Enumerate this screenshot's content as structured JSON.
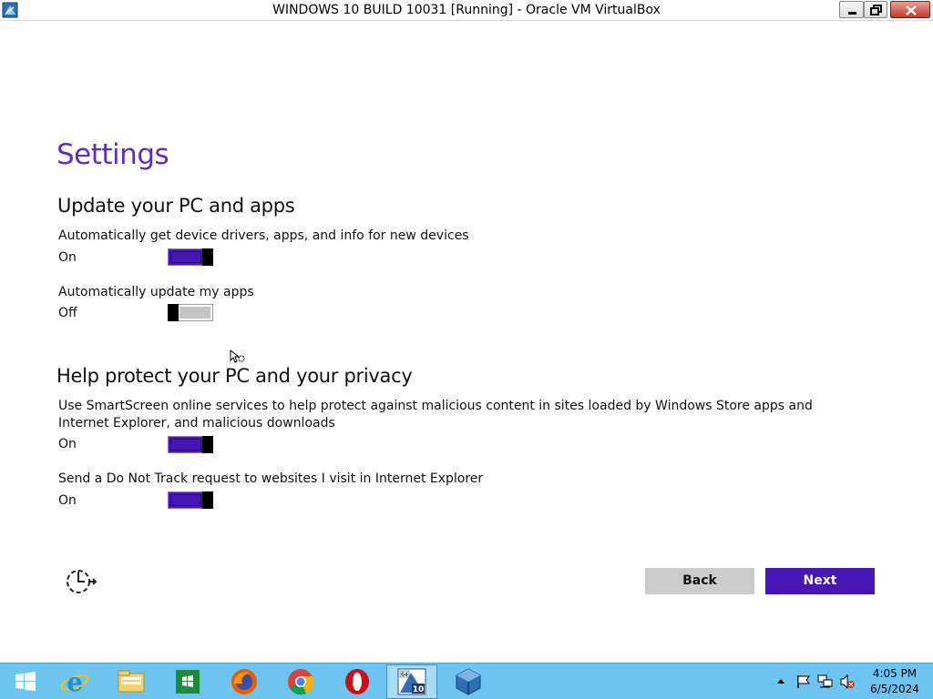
{
  "window": {
    "title": "WINDOWS 10 BUILD 10031 [Running] - Oracle VM VirtualBox",
    "app_icon": "virtualbox-icon",
    "controls": [
      "minimize-icon",
      "restore-icon",
      "close-icon"
    ]
  },
  "page": {
    "title": "Settings",
    "accent_color": "#4617b4",
    "sections": [
      {
        "title": "Update your PC and apps",
        "settings": [
          {
            "description": "Automatically get device drivers, apps, and info for new devices",
            "state": "On"
          },
          {
            "description": "Automatically update my apps",
            "state": "Off"
          }
        ]
      },
      {
        "title": "Help protect your PC and your privacy",
        "settings": [
          {
            "description": "Use SmartScreen online services to help protect against malicious content in sites loaded by Windows Store apps and Internet Explorer, and malicious downloads",
            "state": "On"
          },
          {
            "description": "Send a Do Not Track request to websites I visit in Internet Explorer",
            "state": "On"
          }
        ]
      }
    ],
    "ease_of_access_icon": "ease-of-access-icon"
  },
  "buttons": {
    "back": "Back",
    "next": "Next"
  },
  "taskbar": {
    "color": "#6ec4f0",
    "items": [
      "windows-start-icon",
      "internet-explorer-icon",
      "file-explorer-icon",
      "windows-store-icon",
      "firefox-icon",
      "chrome-icon",
      "opera-icon",
      "windows-10-vm-icon",
      "virtualbox-icon"
    ],
    "tray": [
      "show-hidden-icons-icon",
      "action-center-flag-icon",
      "network-icon",
      "volume-muted-icon"
    ],
    "clock": {
      "time": "4:05 PM",
      "date": "6/5/2024"
    }
  }
}
